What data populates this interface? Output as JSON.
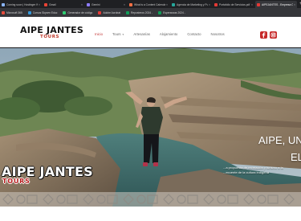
{
  "browser": {
    "tabs": [
      {
        "label": "Coming soon | Hostinger Web"
      },
      {
        "label": "Gmail"
      },
      {
        "label": "Gemini"
      },
      {
        "label": "What is a Content Calendar?"
      },
      {
        "label": "Agencia de Marketing y Publi"
      },
      {
        "label": "Portafolio de Servicios.pdf"
      },
      {
        "label": "AIPEJANTES - Empresa Oper",
        "active": true
      }
    ],
    "bookmarks": [
      {
        "label": "Microsoft 365",
        "color": "#e74c3c"
      },
      {
        "label": "Cursos Skyven Educ",
        "color": "#3498db"
      },
      {
        "label": "Generador de código",
        "color": "#2ecc71"
      },
      {
        "label": "Adobe Acrobat",
        "color": "#e53935"
      },
      {
        "label": "Reposteros 2024 -",
        "color": "#0f9d58"
      },
      {
        "label": "Esperanzas 2024 -",
        "color": "#0f9d58"
      }
    ]
  },
  "site": {
    "logo_main": "AIPE JANTES",
    "logo_sub": "TOURS",
    "nav": [
      {
        "label": "Inicio",
        "active": true
      },
      {
        "label": "Tours",
        "dropdown": true
      },
      {
        "label": "Artesanías"
      },
      {
        "label": "Alojamiento"
      },
      {
        "label": "Contacto"
      },
      {
        "label": "Nosotros"
      }
    ],
    "social": [
      "facebook-icon",
      "instagram-icon"
    ],
    "accent": "#c62828"
  },
  "hero": {
    "title_line1": "AIPE, UNA",
    "title_line2": "EL",
    "subtitle_line1": "...a propuesta de recreación y turismo a la",
    "subtitle_line2": "...ecuente de la cultura indígena",
    "logo_main": "AIPE JANTES",
    "logo_sub": "TOURS"
  }
}
